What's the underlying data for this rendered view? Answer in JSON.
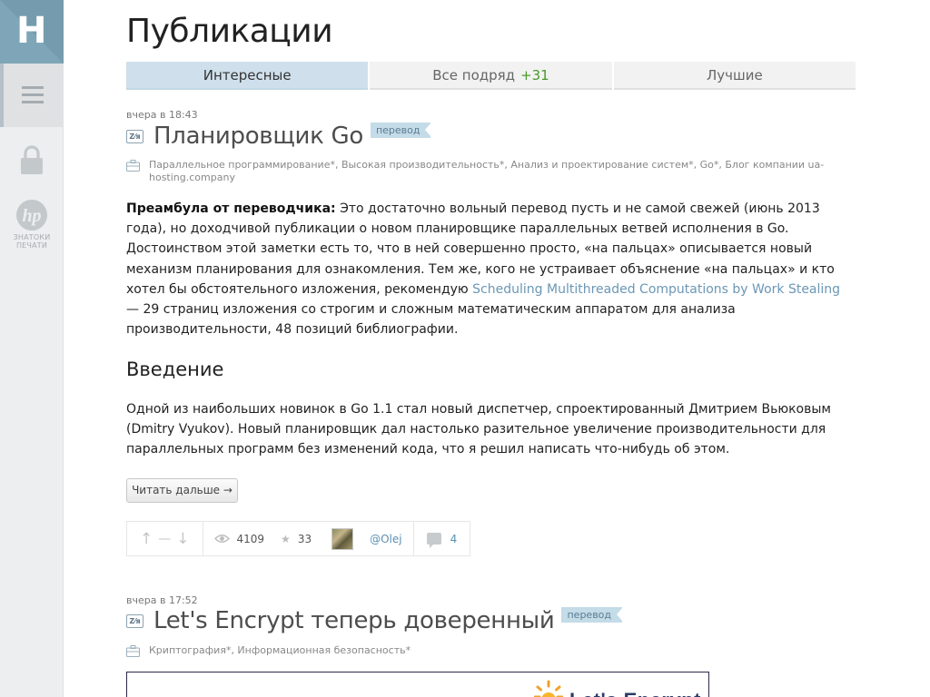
{
  "logo": {
    "letter": "H"
  },
  "rail": {
    "hp_caption": "ЗНАТОКИ ПЕЧАТИ"
  },
  "page": {
    "title": "Публикации"
  },
  "tabs": [
    {
      "label": "Интересные",
      "active": true
    },
    {
      "label": "Все подряд",
      "count": "+31",
      "active": false
    },
    {
      "label": "Лучшие",
      "active": false
    }
  ],
  "posts": [
    {
      "time": "вчера в 18:43",
      "lang_icon": "Z⁄я",
      "title": "Планировщик Go",
      "tag": "перевод",
      "hubs": "Параллельное программирование*, Высокая производительность*, Анализ и проектирование систем*, Go*, Блог компании ua-hosting.company",
      "intro_bold": "Преамбула от переводчика:",
      "intro_text": " Это достаточно вольный перевод пусть и не самой свежей (июнь 2013 года), но доходчивой публикации о новом планировщике параллельных ветвей исполнения в Go. Достоинством этой заметки есть то, что в ней совершенно просто, «на пальцах» описывается новый механизм планирования для ознакомления. Тем же, кого не устраивает объяснение «на пальцах» и кто хотел бы обстоятельного изложения, рекомендую ",
      "intro_link": "Scheduling Multithreaded Computations by Work Stealing",
      "intro_tail": " — 29 страниц изложения со строгим и сложным математическим аппаратом для анализа производительности, 48 позиций библиографии.",
      "heading": "Введение",
      "paragraph": "Одной из наибольших новинок в Go 1.1 стал новый диспетчер, спроектированный Дмитрием Вьюковым (Dmitry Vyukov). Новый планировщик дал настолько разительное увеличение производительности для параллельных программ без изменений кода, что я решил написать что-нибудь об этом.",
      "read_more": "Читать дальше →",
      "vote_up": "↑",
      "score": "—",
      "vote_down": "↓",
      "views": "4109",
      "favorites": "33",
      "author": "@Olej",
      "comments": "4"
    },
    {
      "time": "вчера в 17:52",
      "lang_icon": "Z⁄я",
      "title": "Let's Encrypt теперь доверенный",
      "tag": "перевод",
      "hubs": "Криптография*, Информационная безопасность*",
      "image_text": "Let's Encrypt"
    }
  ],
  "icons": [
    "menu-icon",
    "lock-icon",
    "hp-icon",
    "translation-icon",
    "briefcase-icon",
    "eye-icon",
    "star-icon",
    "comment-icon",
    "sun-icon"
  ],
  "colors": {
    "accent": "#7fa6b8",
    "active_tab": "#cfe0ec",
    "link": "#6b97b5",
    "count_green": "#4a9a2a",
    "tag_bg": "#c4dbe8"
  }
}
